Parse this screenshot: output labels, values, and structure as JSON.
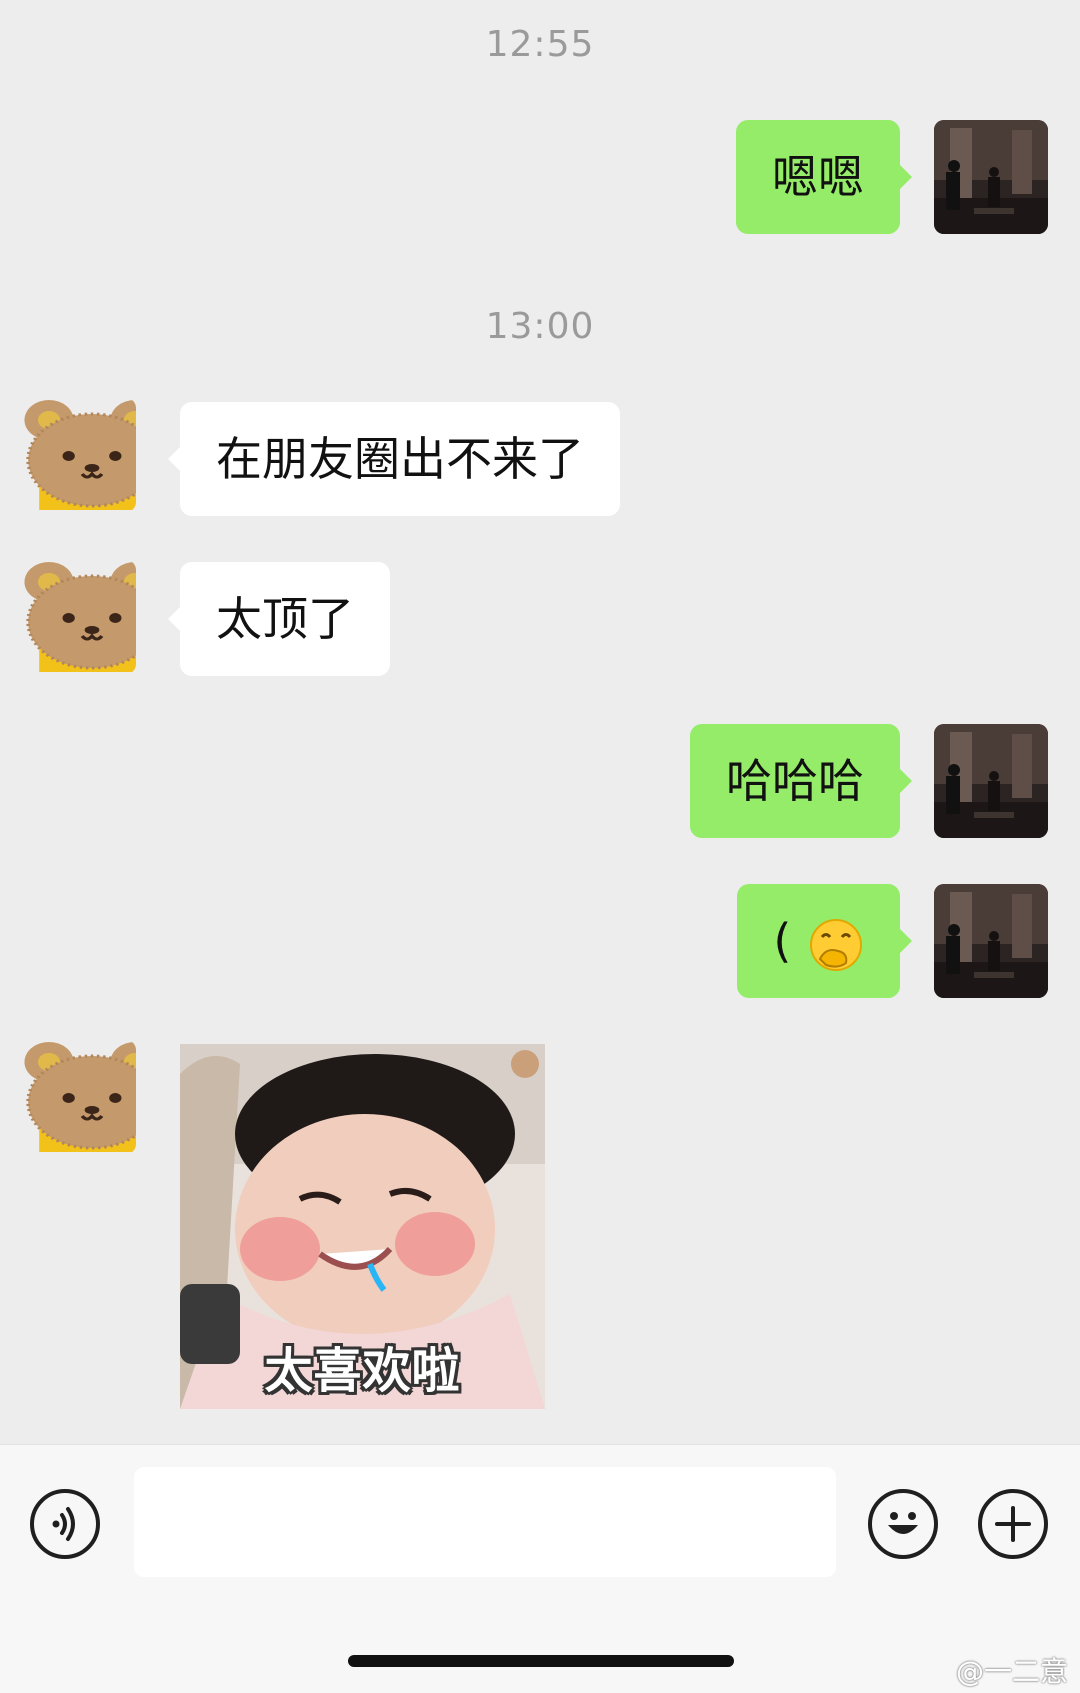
{
  "chat": {
    "timestamps": [
      "12:55",
      "13:00"
    ],
    "messages": [
      {
        "from": "me",
        "text": "嗯嗯"
      },
      {
        "from": "friend",
        "text": "在朋友圈出不来了"
      },
      {
        "from": "friend",
        "text": "太顶了"
      },
      {
        "from": "me",
        "text": "哈哈哈"
      },
      {
        "from": "me",
        "text": "(",
        "emoji": "hand-over-mouth-emoji"
      },
      {
        "from": "friend",
        "type": "sticker",
        "caption": "太喜欢啦"
      }
    ]
  },
  "input_bar": {
    "placeholder": "",
    "voice_icon": "voice-icon",
    "emoji_icon": "smiley-icon",
    "more_icon": "plus-icon"
  },
  "watermark": "@一二意",
  "colors": {
    "background": "#ededed",
    "my_bubble": "#95ec69",
    "friend_bubble": "#ffffff",
    "timestamp": "#9a9a9a"
  }
}
